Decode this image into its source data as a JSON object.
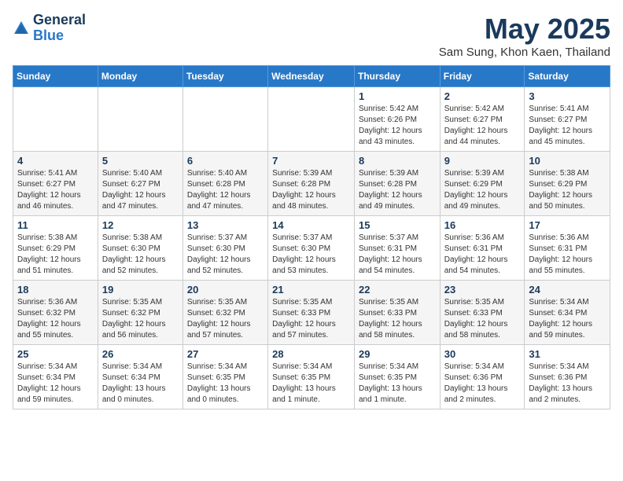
{
  "logo": {
    "general": "General",
    "blue": "Blue"
  },
  "header": {
    "month": "May 2025",
    "location": "Sam Sung, Khon Kaen, Thailand"
  },
  "weekdays": [
    "Sunday",
    "Monday",
    "Tuesday",
    "Wednesday",
    "Thursday",
    "Friday",
    "Saturday"
  ],
  "weeks": [
    [
      {
        "day": "",
        "info": ""
      },
      {
        "day": "",
        "info": ""
      },
      {
        "day": "",
        "info": ""
      },
      {
        "day": "",
        "info": ""
      },
      {
        "day": "1",
        "info": "Sunrise: 5:42 AM\nSunset: 6:26 PM\nDaylight: 12 hours\nand 43 minutes."
      },
      {
        "day": "2",
        "info": "Sunrise: 5:42 AM\nSunset: 6:27 PM\nDaylight: 12 hours\nand 44 minutes."
      },
      {
        "day": "3",
        "info": "Sunrise: 5:41 AM\nSunset: 6:27 PM\nDaylight: 12 hours\nand 45 minutes."
      }
    ],
    [
      {
        "day": "4",
        "info": "Sunrise: 5:41 AM\nSunset: 6:27 PM\nDaylight: 12 hours\nand 46 minutes."
      },
      {
        "day": "5",
        "info": "Sunrise: 5:40 AM\nSunset: 6:27 PM\nDaylight: 12 hours\nand 47 minutes."
      },
      {
        "day": "6",
        "info": "Sunrise: 5:40 AM\nSunset: 6:28 PM\nDaylight: 12 hours\nand 47 minutes."
      },
      {
        "day": "7",
        "info": "Sunrise: 5:39 AM\nSunset: 6:28 PM\nDaylight: 12 hours\nand 48 minutes."
      },
      {
        "day": "8",
        "info": "Sunrise: 5:39 AM\nSunset: 6:28 PM\nDaylight: 12 hours\nand 49 minutes."
      },
      {
        "day": "9",
        "info": "Sunrise: 5:39 AM\nSunset: 6:29 PM\nDaylight: 12 hours\nand 49 minutes."
      },
      {
        "day": "10",
        "info": "Sunrise: 5:38 AM\nSunset: 6:29 PM\nDaylight: 12 hours\nand 50 minutes."
      }
    ],
    [
      {
        "day": "11",
        "info": "Sunrise: 5:38 AM\nSunset: 6:29 PM\nDaylight: 12 hours\nand 51 minutes."
      },
      {
        "day": "12",
        "info": "Sunrise: 5:38 AM\nSunset: 6:30 PM\nDaylight: 12 hours\nand 52 minutes."
      },
      {
        "day": "13",
        "info": "Sunrise: 5:37 AM\nSunset: 6:30 PM\nDaylight: 12 hours\nand 52 minutes."
      },
      {
        "day": "14",
        "info": "Sunrise: 5:37 AM\nSunset: 6:30 PM\nDaylight: 12 hours\nand 53 minutes."
      },
      {
        "day": "15",
        "info": "Sunrise: 5:37 AM\nSunset: 6:31 PM\nDaylight: 12 hours\nand 54 minutes."
      },
      {
        "day": "16",
        "info": "Sunrise: 5:36 AM\nSunset: 6:31 PM\nDaylight: 12 hours\nand 54 minutes."
      },
      {
        "day": "17",
        "info": "Sunrise: 5:36 AM\nSunset: 6:31 PM\nDaylight: 12 hours\nand 55 minutes."
      }
    ],
    [
      {
        "day": "18",
        "info": "Sunrise: 5:36 AM\nSunset: 6:32 PM\nDaylight: 12 hours\nand 55 minutes."
      },
      {
        "day": "19",
        "info": "Sunrise: 5:35 AM\nSunset: 6:32 PM\nDaylight: 12 hours\nand 56 minutes."
      },
      {
        "day": "20",
        "info": "Sunrise: 5:35 AM\nSunset: 6:32 PM\nDaylight: 12 hours\nand 57 minutes."
      },
      {
        "day": "21",
        "info": "Sunrise: 5:35 AM\nSunset: 6:33 PM\nDaylight: 12 hours\nand 57 minutes."
      },
      {
        "day": "22",
        "info": "Sunrise: 5:35 AM\nSunset: 6:33 PM\nDaylight: 12 hours\nand 58 minutes."
      },
      {
        "day": "23",
        "info": "Sunrise: 5:35 AM\nSunset: 6:33 PM\nDaylight: 12 hours\nand 58 minutes."
      },
      {
        "day": "24",
        "info": "Sunrise: 5:34 AM\nSunset: 6:34 PM\nDaylight: 12 hours\nand 59 minutes."
      }
    ],
    [
      {
        "day": "25",
        "info": "Sunrise: 5:34 AM\nSunset: 6:34 PM\nDaylight: 12 hours\nand 59 minutes."
      },
      {
        "day": "26",
        "info": "Sunrise: 5:34 AM\nSunset: 6:34 PM\nDaylight: 13 hours\nand 0 minutes."
      },
      {
        "day": "27",
        "info": "Sunrise: 5:34 AM\nSunset: 6:35 PM\nDaylight: 13 hours\nand 0 minutes."
      },
      {
        "day": "28",
        "info": "Sunrise: 5:34 AM\nSunset: 6:35 PM\nDaylight: 13 hours\nand 1 minute."
      },
      {
        "day": "29",
        "info": "Sunrise: 5:34 AM\nSunset: 6:35 PM\nDaylight: 13 hours\nand 1 minute."
      },
      {
        "day": "30",
        "info": "Sunrise: 5:34 AM\nSunset: 6:36 PM\nDaylight: 13 hours\nand 2 minutes."
      },
      {
        "day": "31",
        "info": "Sunrise: 5:34 AM\nSunset: 6:36 PM\nDaylight: 13 hours\nand 2 minutes."
      }
    ]
  ]
}
